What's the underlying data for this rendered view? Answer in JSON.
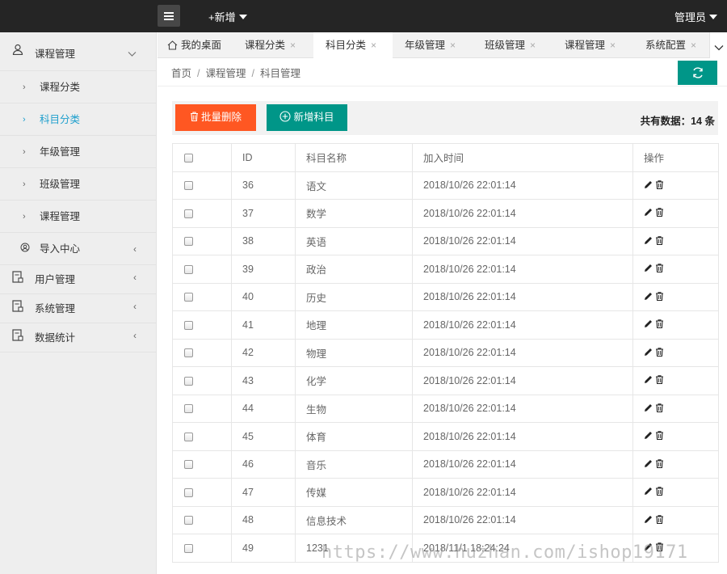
{
  "topbar": {
    "menu_icon": "list-icon",
    "new_label": "+新增",
    "admin_label": "管理员"
  },
  "sidebar": {
    "items": [
      {
        "label": "课程管理",
        "icon": "user-icon"
      },
      {
        "label": "课程分类"
      },
      {
        "label": "科目分类"
      },
      {
        "label": "年级管理"
      },
      {
        "label": "班级管理"
      },
      {
        "label": "课程管理"
      },
      {
        "label": "导入中心",
        "icon": "user-circle-icon"
      },
      {
        "label": "用户管理",
        "icon": "document-icon"
      },
      {
        "label": "系统管理",
        "icon": "document-icon"
      },
      {
        "label": "数据统计",
        "icon": "document-icon"
      }
    ]
  },
  "tabs": {
    "items": [
      {
        "label": "我的桌面"
      },
      {
        "label": "课程分类"
      },
      {
        "label": "科目分类"
      },
      {
        "label": "年级管理"
      },
      {
        "label": "班级管理"
      },
      {
        "label": "课程管理"
      },
      {
        "label": "系统配置"
      }
    ],
    "close_glyph": "×"
  },
  "breadcrumb": {
    "home": "首页",
    "parent": "课程管理",
    "current": "科目管理",
    "separator": "/"
  },
  "toolbar": {
    "delete_label": "批量删除",
    "add_label": "新增科目",
    "total_label": "共有数据：14 条"
  },
  "colors": {
    "topbar": "#252525",
    "accent_teal": "#009688",
    "danger_orange": "#ff5722",
    "active_link": "#1e9fcd"
  },
  "table": {
    "headers": [
      "ID",
      "科目名称",
      "加入时间",
      "操作"
    ],
    "rows": [
      {
        "id": "36",
        "name": "语文",
        "time": "2018/10/26 22:01:14"
      },
      {
        "id": "37",
        "name": "数学",
        "time": "2018/10/26 22:01:14"
      },
      {
        "id": "38",
        "name": "英语",
        "time": "2018/10/26 22:01:14"
      },
      {
        "id": "39",
        "name": "政治",
        "time": "2018/10/26 22:01:14"
      },
      {
        "id": "40",
        "name": "历史",
        "time": "2018/10/26 22:01:14"
      },
      {
        "id": "41",
        "name": "地理",
        "time": "2018/10/26 22:01:14"
      },
      {
        "id": "42",
        "name": "物理",
        "time": "2018/10/26 22:01:14"
      },
      {
        "id": "43",
        "name": "化学",
        "time": "2018/10/26 22:01:14"
      },
      {
        "id": "44",
        "name": "生物",
        "time": "2018/10/26 22:01:14"
      },
      {
        "id": "45",
        "name": "体育",
        "time": "2018/10/26 22:01:14"
      },
      {
        "id": "46",
        "name": "音乐",
        "time": "2018/10/26 22:01:14"
      },
      {
        "id": "47",
        "name": "传媒",
        "time": "2018/10/26 22:01:14"
      },
      {
        "id": "48",
        "name": "信息技术",
        "time": "2018/10/26 22:01:14"
      },
      {
        "id": "49",
        "name": "1231",
        "time": "2018/11/1 18:24:24"
      }
    ]
  },
  "watermark": "https://www.huzhan.com/ishop19171"
}
